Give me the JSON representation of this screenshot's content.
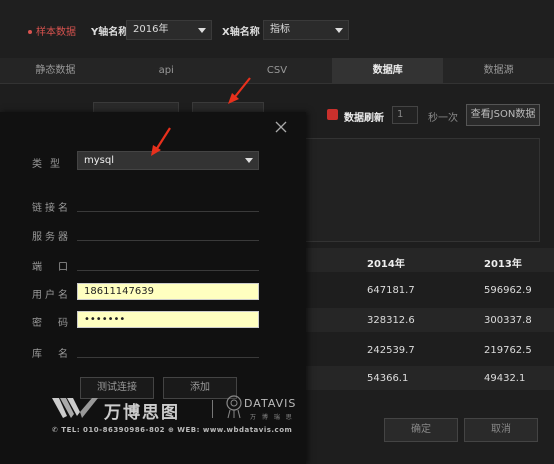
{
  "toolbar": {
    "sample_label": "样本数据",
    "y_axis_label": "Y轴名称",
    "y_axis_value": "2016年",
    "x_axis_label": "X轴名称",
    "x_axis_value": "指标"
  },
  "tabs": [
    {
      "label": "静态数据",
      "active": false
    },
    {
      "label": "api",
      "active": false
    },
    {
      "label": "CSV",
      "active": false
    },
    {
      "label": "数据库",
      "active": true
    },
    {
      "label": "数据源",
      "active": false
    }
  ],
  "refresh": {
    "label": "数据刷新",
    "interval_value": "1",
    "interval_suffix": "秒一次",
    "json_button": "查看JSON数据"
  },
  "table": {
    "headers": [
      "2014年",
      "2013年"
    ],
    "rows": [
      [
        "647181.7",
        "596962.9"
      ],
      [
        "328312.6",
        "300337.8"
      ],
      [
        "242539.7",
        "219762.5"
      ],
      [
        "54366.1",
        "49432.1"
      ]
    ]
  },
  "footer": {
    "confirm": "确定",
    "cancel": "取消"
  },
  "modal": {
    "type_label": "类型",
    "type_value": "mysql",
    "link_name_label": "链接名",
    "server_label": "服务器",
    "port_label": "端口",
    "username_label": "用户名",
    "username_value": "18611147639",
    "password_label": "密码",
    "password_value": "•••••••",
    "db_label": "库名",
    "test_button": "测试连接",
    "add_button": "添加"
  },
  "watermark": {
    "brand_cn": "万博思图",
    "brand_en": "DATAVIS",
    "brand_en_sub": "万 博 瑞 思",
    "contact": "✆ TEL: 010-86390986-802   ⊕ WEB: www.wbdatavis.com"
  },
  "colors": {
    "accent_red": "#d9534f",
    "highlight_input": "#ffffc0",
    "arrow_red": "#e8301c"
  }
}
